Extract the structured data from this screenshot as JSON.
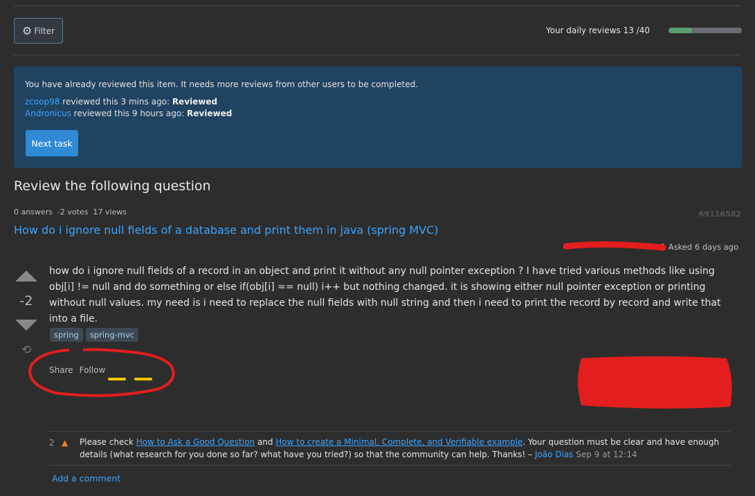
{
  "toolbar": {
    "filter_label": "Filter",
    "daily_reviews_label": "Your daily reviews 13 /40",
    "daily_reviews_progress": 0.325
  },
  "notice": {
    "message": "You have already reviewed this item. It needs more reviews from other users to be completed.",
    "reviews": [
      {
        "user": "zcoop98",
        "text": " reviewed this 3 mins ago: ",
        "result": "Reviewed"
      },
      {
        "user": "Andronicus",
        "text": " reviewed this 9 hours ago: ",
        "result": "Reviewed"
      }
    ],
    "next_label": "Next task"
  },
  "heading": "Review the following question",
  "question": {
    "stats": "0 answers  -2 votes  17 views",
    "id": "69116582",
    "title": "How do i ignore null fields of a database and print them in java (spring MVC)",
    "asked": "1 Asked 6 days ago",
    "votes": "-2",
    "body": "how do i ignore null fields of a record in an object and print it without any null pointer exception ? I have tried various methods like using obj[i] != null and do something or else if(obj[i] == null) i++ but nothing changed. it is showing either null pointer exception or printing without null values. my need is i need to replace the null fields with null string and then i need to print the record by record and write that into a file.",
    "tags": [
      "spring",
      "spring-mvc"
    ],
    "share_label": "Share",
    "follow_label": "Follow"
  },
  "comment": {
    "score": "2",
    "pre": "Please check ",
    "link1": "How to Ask a Good Question",
    "mid": " and ",
    "link2": "How to create a Minimal, Complete, and Verifiable example",
    "post": ". Your question must be clear and have enough details (what research for you done so far? what have you tried?) so that the community can help. Thanks! – ",
    "author": "João Dias",
    "date": " Sep 9 at 12:14"
  },
  "add_comment_label": "Add a comment",
  "colors": {
    "accent": "#3ca4ff",
    "notice_bg": "#1f4361",
    "progress": "#5a9e6f",
    "annotation": "#e31e1e"
  }
}
